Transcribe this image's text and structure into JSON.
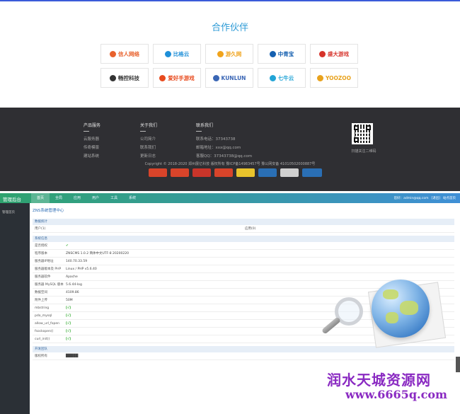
{
  "partners": {
    "title": "合作伙伴",
    "logos": [
      {
        "name": "信人网络",
        "color": "#e8612c"
      },
      {
        "name": "比格云",
        "color": "#1e8fd8"
      },
      {
        "name": "游久网",
        "color": "#f0a31b"
      },
      {
        "name": "中青宝",
        "color": "#1560b0"
      },
      {
        "name": "盛大游戏",
        "color": "#d6322a"
      },
      {
        "name": "畅控科技",
        "color": "#333333"
      },
      {
        "name": "爱好手游戏",
        "color": "#e84a1d"
      },
      {
        "name": "KUNLUN",
        "color": "#3a66b5"
      },
      {
        "name": "七牛云",
        "color": "#22a4d6"
      },
      {
        "name": "YOOZOO",
        "color": "#e8a21d"
      }
    ]
  },
  "footer": {
    "columns": [
      {
        "title": "产品服务",
        "links": [
          "云服务器",
          "传奇模版",
          "建站系统"
        ]
      },
      {
        "title": "关于我们",
        "links": [
          "公司简介",
          "联系我们",
          "更新日志"
        ]
      },
      {
        "title": "联系我们",
        "links": [
          "联系电话：37343738",
          "邮箱地址：xxx@qq.com",
          "客服QQ：37343738@qq.com"
        ]
      }
    ],
    "qr_caption": "扫描关注二维码",
    "copyright": "Copyright © 2018-2020 郑州展亿科技 版权所有 豫ICP备14983457号 豫公网安备 41010502000887号",
    "badges": [
      {
        "label": "badge-1",
        "color": "#d8442a"
      },
      {
        "label": "badge-2",
        "color": "#d8442a"
      },
      {
        "label": "badge-3",
        "color": "#c9352a"
      },
      {
        "label": "badge-4",
        "color": "#d8442a"
      },
      {
        "label": "badge-5",
        "color": "#e8c32c"
      },
      {
        "label": "badge-6",
        "color": "#2a6fb5"
      },
      {
        "label": "badge-7",
        "color": "#d0d0d0"
      },
      {
        "label": "badge-8",
        "color": "#2a6fb5"
      }
    ]
  },
  "admin": {
    "brand": "管理后台",
    "nav": [
      "首页",
      "全局",
      "应用",
      "用户",
      "工具",
      "系统"
    ],
    "user": [
      "您好：admin@qq.com",
      "[退出]",
      "站点首页"
    ],
    "sidebar_item": "管理首页",
    "page_title": "ZNS系统管理中心",
    "sections": [
      {
        "title": "数据统计",
        "rows": [
          {
            "label": "用户(1)",
            "value": "",
            "label2": "应用(0)"
          }
        ]
      },
      {
        "title": "系统信息",
        "rows": [
          {
            "label": "是否授权",
            "value": "✔",
            "green": true
          },
          {
            "label": "程序版本",
            "value": "ZNSCMS 1.0.2 简体中文UTF-8 20200220"
          },
          {
            "label": "服务器IP地址",
            "value": "140.70.33.59"
          },
          {
            "label": "服务器版本及 PHP",
            "value": "Linux / PHP v5.6.40"
          },
          {
            "label": "服务器软件",
            "value": "Apache"
          },
          {
            "label": "服务器 MySQL 版本",
            "value": "5.6.44-log"
          },
          {
            "label": "数据空间",
            "value": "4109.86"
          },
          {
            "label": "附件上传",
            "value": "50M"
          },
          {
            "label": "mbstring",
            "value": "[√]",
            "green": true
          },
          {
            "label": "pdo_mysql",
            "value": "[√]",
            "green": true
          },
          {
            "label": "allow_url_fopen",
            "value": "[√]",
            "green": true
          },
          {
            "label": "fsockopen()",
            "value": "[√]",
            "green": true
          },
          {
            "label": "curl_init()",
            "value": "[√]",
            "green": true
          }
        ]
      },
      {
        "title": "开发团队",
        "rows": [
          {
            "label": "版权所有",
            "value": "█████"
          }
        ]
      }
    ]
  },
  "watermark": {
    "text": "润水天城资源网",
    "url": "www.6665q.com"
  }
}
